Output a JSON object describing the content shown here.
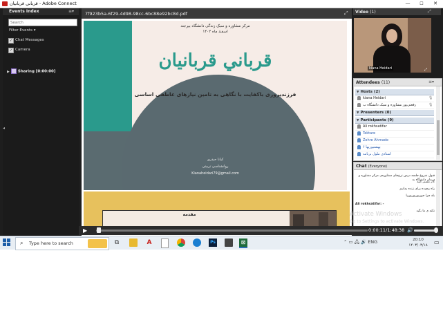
{
  "window": {
    "title": "قرباني قربانيان - Adobe Connect",
    "minimize": "—",
    "maximize": "☐",
    "close": "✕"
  },
  "events_index": {
    "title": "Events Index",
    "menu_icon": "≡▾",
    "search_placeholder": "Search",
    "filter_label": "Filter Events",
    "filters": [
      {
        "label": "Chat Messages",
        "checked": true
      },
      {
        "label": "Camera",
        "checked": true
      }
    ],
    "sharing_label": "Sharing [0:00:00]"
  },
  "document": {
    "filename": "7f923b5a-6f29-4d98-98cc-6bc88e92bc8d.pdf",
    "slide": {
      "header_line1": "مرکز مشاوره و سبک زندگی دانشگاه بیرجند",
      "header_line2": "اسفند ماه ۱۴۰۲",
      "title": "قرباني قربانيان",
      "subtitle": "فرزندپروری باکفایت با نگاهی به تامین نیازهای عاطفی اساسی",
      "author_name": "کیانا حیدری",
      "author_role": "روانشناسی تربیتی",
      "author_email": "Kianaheidari79@gmail.com"
    },
    "next_slide_title": "مقدمه"
  },
  "video": {
    "title": "Video",
    "count": "(1)",
    "presenter_name": "kiana Heidari"
  },
  "attendees": {
    "title": "Attendees",
    "count": "(11)",
    "hosts_label": "Hosts (2)",
    "hosts": [
      "kiana Heidari",
      "رفعتی‌پور مشاوره و سبک دانشگاه ب"
    ],
    "presenters_label": "Presenters (0)",
    "participants_label": "Participants (9)",
    "participants": [
      "Ali rokhsatifar",
      "Tektare",
      "Zohre Ahmade",
      "۶ بهشتیوریها",
      "استادی ملول برنامه"
    ]
  },
  "chat": {
    "title": "Chat",
    "scope": "(Everyone)",
    "messages": [
      "قبول شروع جلسه درس نرخ‌های مشاوره‌ی مرکز مشاوره و درمان دانشگاه به",
      "کار مستر کنید",
      "راه پیچیده برای زنده بمانیم",
      "بله چرا جوریوریوریوریا",
      "Ali rokhsatifar: -",
      "نکته ی ما بگید"
    ]
  },
  "watermark": {
    "line1": "Activate Windows",
    "line2": "Go to Settings to activate Windows."
  },
  "player": {
    "play": "▶",
    "time": "0:00:11/1:48:38",
    "speaker": "🔊",
    "progress_fraction": 0.01,
    "volume_fraction": 0.9
  },
  "taskbar": {
    "search_text": "Type here to search",
    "tray_text": "⌃ ▭ 🖧 🔊 ENG",
    "time": "20:10",
    "date": "۱۴۰۳/۰۳/۱۸",
    "icons": [
      "task-view",
      "explorer",
      "acrobat",
      "document",
      "chrome",
      "edge",
      "photoshop",
      "media",
      "adobe-connect"
    ]
  }
}
